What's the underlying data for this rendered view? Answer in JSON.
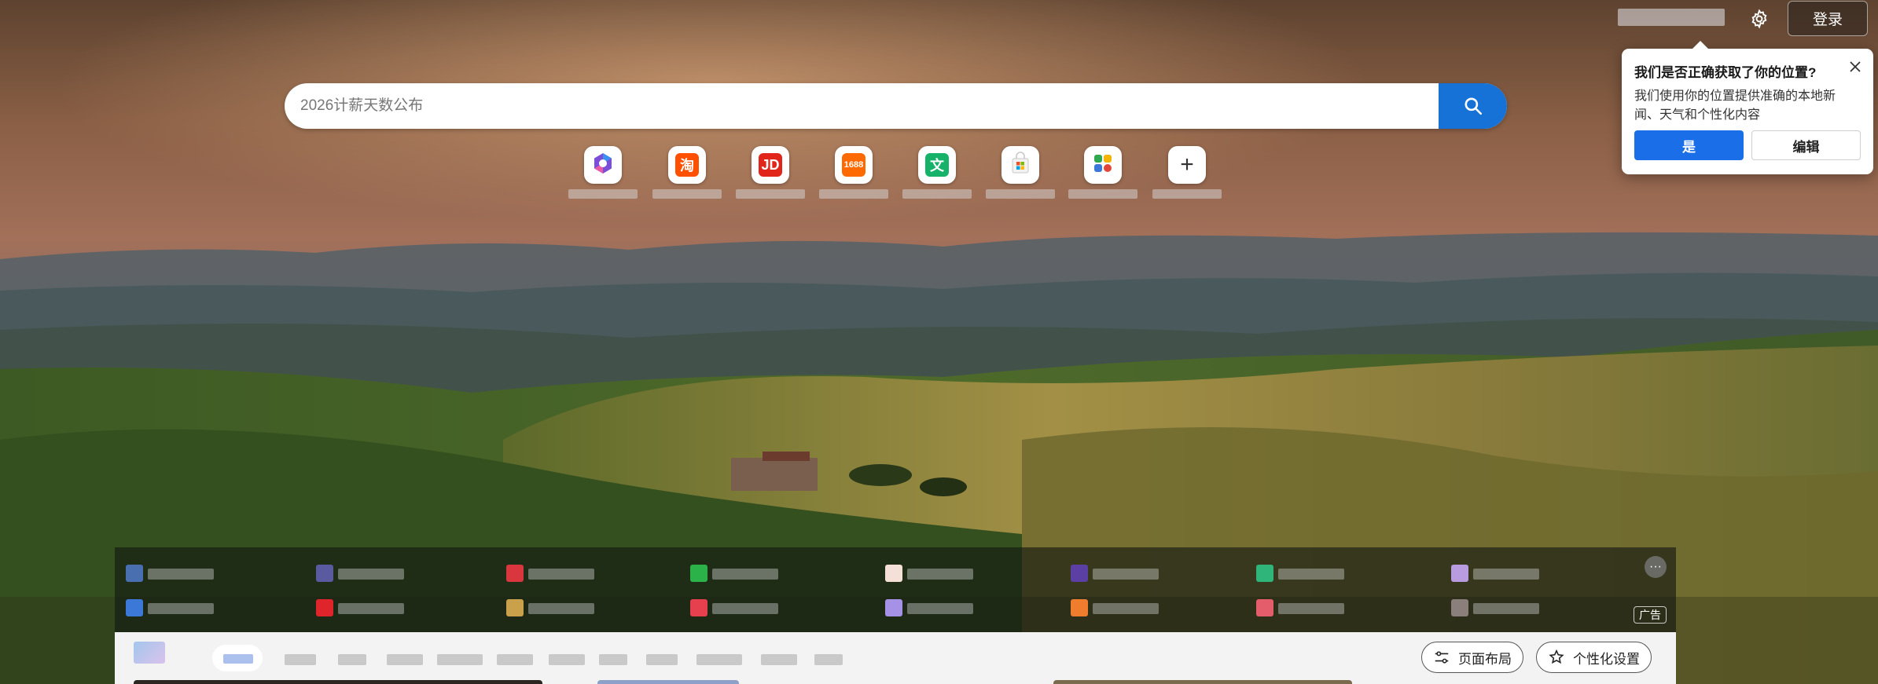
{
  "header": {
    "login_label": "登录",
    "settings_icon": "gear-icon"
  },
  "location_prompt": {
    "title": "我们是否正确获取了你的位置?",
    "description": "我们使用你的位置提供准确的本地新闻、天气和个性化内容",
    "yes_label": "是",
    "edit_label": "编辑"
  },
  "search": {
    "placeholder": "2026计薪天数公布",
    "icon": "search-icon"
  },
  "quick_links": [
    {
      "name": "copilot-icon",
      "color": "#7b4ed8"
    },
    {
      "name": "taobao-icon",
      "text": "淘",
      "color": "#ff5000"
    },
    {
      "name": "jd-icon",
      "text": "JD",
      "color": "#e1251b"
    },
    {
      "name": "1688-icon",
      "text": "1688",
      "color": "#ff6a00"
    },
    {
      "name": "wenku-icon",
      "text": "文",
      "color": "#17b26a"
    },
    {
      "name": "store-icon",
      "color": "#f2b400"
    },
    {
      "name": "apps-icon",
      "color": "#2fa84f"
    },
    {
      "name": "add-icon",
      "text": "+",
      "color": "#333333"
    }
  ],
  "promo": {
    "ad_label": "广告",
    "more_label": "···",
    "icon_colors": [
      "#4a6fb0",
      "#5a5aa0",
      "#d9363e",
      "#2bb34a",
      "#f4e0d6",
      "#5b3fa2",
      "#2fb57a",
      "#b99be0",
      "#3b78d8",
      "#e0242c",
      "#c9a14a",
      "#e6404f",
      "#a592e6",
      "#f07d2e",
      "#e35d6a",
      "#8a7f7a"
    ]
  },
  "feed": {
    "layout_label": "页面布局",
    "personalize_label": "个性化设置"
  },
  "colors": {
    "accent": "#1a6fe8",
    "search_button": "#1672d6"
  }
}
